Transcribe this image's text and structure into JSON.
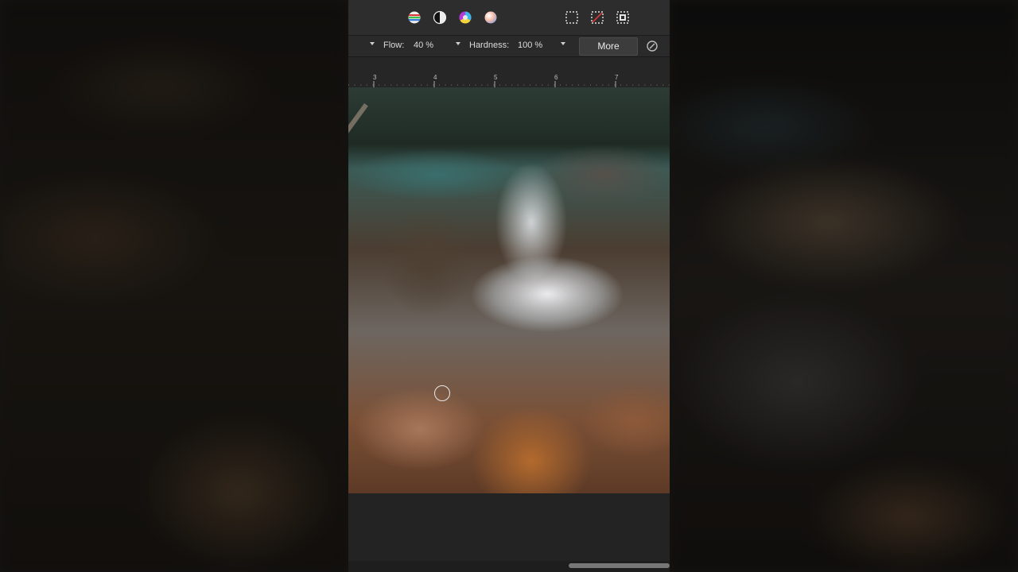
{
  "toolbar": {
    "left_icons": [
      "hsl-adjustment-icon",
      "contrast-icon",
      "color-wheel-icon",
      "gradient-sphere-icon"
    ],
    "right_icons": [
      "marquee-select-icon",
      "deselect-icon",
      "invert-selection-icon"
    ]
  },
  "context": {
    "flow_label": "Flow:",
    "flow_value": "40 %",
    "hardness_label": "Hardness:",
    "hardness_value": "100 %",
    "more_label": "More"
  },
  "ruler": {
    "labels": [
      "3",
      "4",
      "5",
      "6",
      "7"
    ]
  },
  "colors": {
    "app_bg": "#232323",
    "toolbar_bg": "#2d2d2d",
    "button_bg": "#3c3c3c",
    "text": "#dcdcdc"
  }
}
